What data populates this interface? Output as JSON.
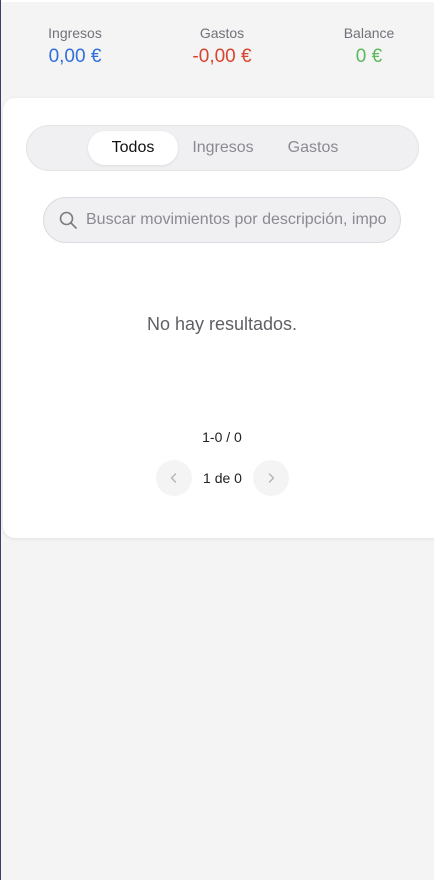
{
  "summary": {
    "income": {
      "label": "Ingresos",
      "value": "0,00 €",
      "color": "#2f6fdc"
    },
    "expense": {
      "label": "Gastos",
      "value": "-0,00 €",
      "color": "#d9442f"
    },
    "balance": {
      "label": "Balance",
      "value": "0 €",
      "color": "#5cb85c"
    }
  },
  "tabs": [
    {
      "label": "Todos",
      "active": true
    },
    {
      "label": "Ingresos",
      "active": false
    },
    {
      "label": "Gastos",
      "active": false
    }
  ],
  "search": {
    "placeholder": "Buscar movimientos por descripción, importe...",
    "value": "",
    "icon": "search-icon"
  },
  "results": {
    "empty_message": "No hay resultados."
  },
  "pagination": {
    "range": "1-0 / 0",
    "page_text": "1 de 0",
    "prev_icon": "chevron-left-icon",
    "next_icon": "chevron-right-icon"
  }
}
